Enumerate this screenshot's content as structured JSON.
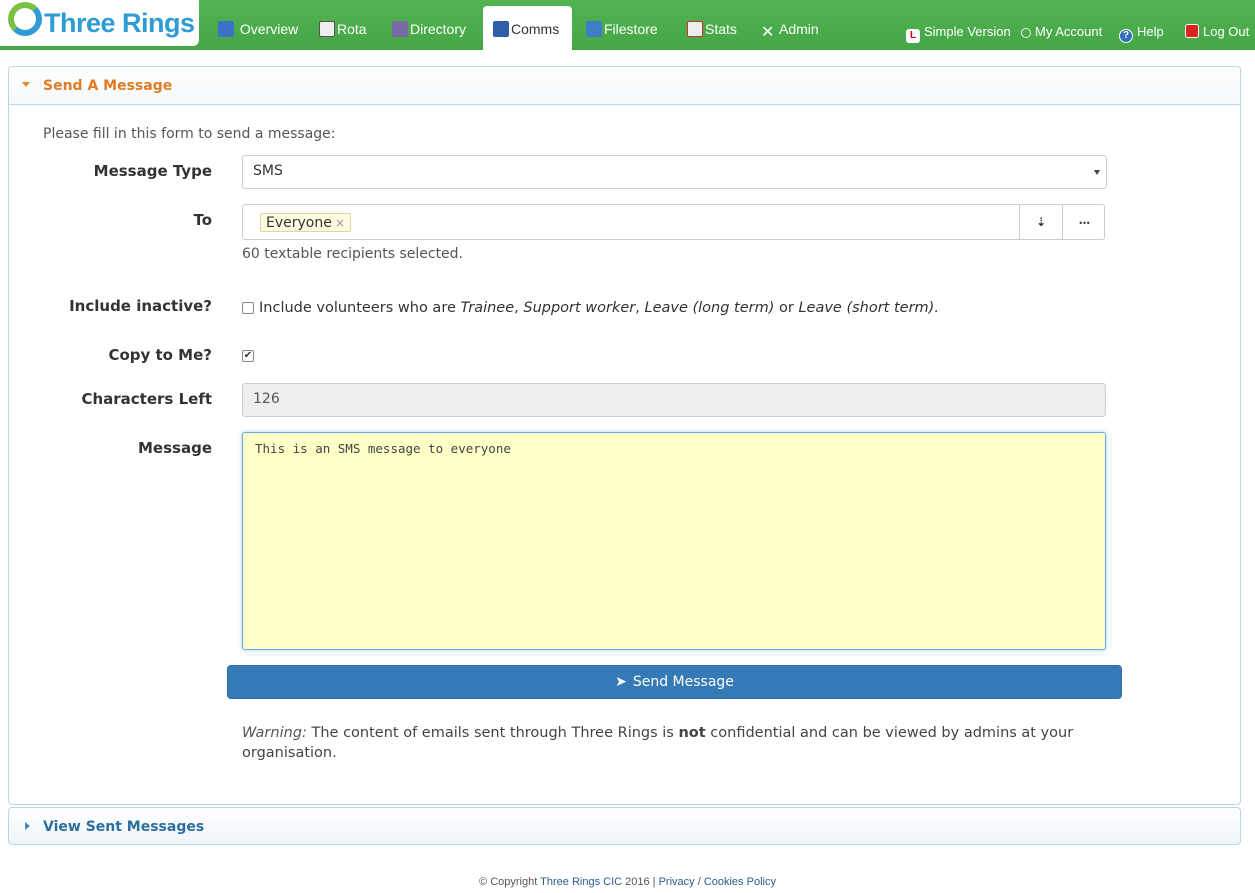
{
  "app": {
    "name": "Three Rings"
  },
  "nav": {
    "tabs": [
      {
        "label": "Overview"
      },
      {
        "label": "Rota"
      },
      {
        "label": "Directory"
      },
      {
        "label": "Comms"
      },
      {
        "label": "Filestore"
      },
      {
        "label": "Stats"
      },
      {
        "label": "Admin"
      }
    ],
    "active_tab": "Comms",
    "right_links": [
      {
        "label": "Simple Version"
      },
      {
        "label": "My Account"
      },
      {
        "label": "Help"
      },
      {
        "label": "Log Out"
      }
    ]
  },
  "send_panel": {
    "title": "Send A Message",
    "intro": "Please fill in this form to send a message:",
    "message_type": {
      "label": "Message Type",
      "value": "SMS"
    },
    "to": {
      "label": "To",
      "chip": "Everyone",
      "chip_remove": "×",
      "help": "60 textable recipients selected.",
      "sort_icon": "sort-icon",
      "more_icon": "more-icon",
      "more_label": "•••"
    },
    "include_inactive": {
      "label": "Include inactive?",
      "checked": false,
      "prefix": "Include volunteers who are ",
      "s1": "Trainee",
      "c1": ", ",
      "s2": "Support worker",
      "c2": ", ",
      "s3": "Leave (long term)",
      "or": " or ",
      "s4": "Leave (short term)",
      "end": "."
    },
    "copy_to_me": {
      "label": "Copy to Me?",
      "checked": true,
      "mark": "✔"
    },
    "characters_left": {
      "label": "Characters Left",
      "value": "126"
    },
    "message": {
      "label": "Message",
      "value": "This is an SMS message to everyone"
    },
    "send_button": "Send Message",
    "warning": {
      "prefix": "Warning:",
      "part1": " The content of emails sent through Three Rings is ",
      "bold": "not",
      "part2": " confidential and can be viewed by admins at your organisation."
    }
  },
  "sent_panel": {
    "title": "View Sent Messages"
  },
  "footer": {
    "copyright": "© Copyright ",
    "org": "Three Rings CIC",
    "year": " 2016 | ",
    "privacy": "Privacy",
    "sep": " / ",
    "cookies": "Cookies Policy"
  },
  "colors": {
    "topbar": "#4cae4c",
    "accent": "#e07b24",
    "primary": "#337ab7",
    "textarea_bg": "#ffffc8"
  }
}
